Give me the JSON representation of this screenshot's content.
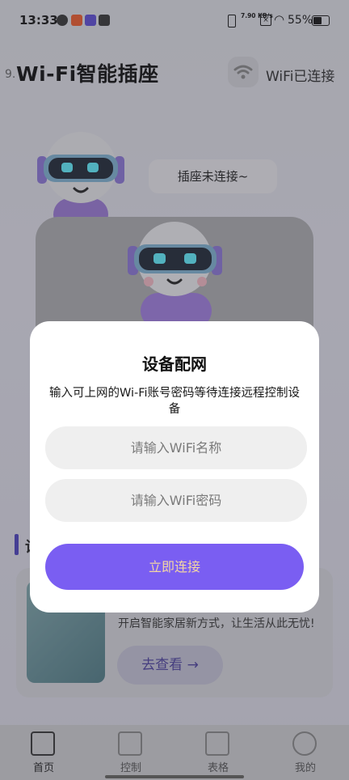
{
  "status_bar": {
    "time": "13:33",
    "network_speed": "7.90 KB/s",
    "battery": "55%"
  },
  "header": {
    "title": "Wi-Fi智能插座",
    "wifi_status": "WiFi已连接",
    "small_prefix": "9."
  },
  "device": {
    "status_chip": "插座未连接~"
  },
  "section": {
    "title_partial": "设"
  },
  "promo": {
    "text": "开启智能家居新方式，让生活从此无忧!",
    "button_label": "去查看 →"
  },
  "bottom_nav": {
    "items": [
      {
        "label": "首页",
        "icon": "home-icon",
        "active": true
      },
      {
        "label": "控制",
        "icon": "control-icon",
        "active": false
      },
      {
        "label": "表格",
        "icon": "table-icon",
        "active": false
      },
      {
        "label": "我的",
        "icon": "profile-icon",
        "active": false
      }
    ]
  },
  "dialog": {
    "title": "设备配网",
    "description": "输入可上网的Wi-Fi账号密码等待连接远程控制设备",
    "ssid_placeholder": "请输入WiFi名称",
    "password_placeholder": "请输入WiFi密码",
    "connect_label": "立即连接"
  },
  "colors": {
    "accent": "#7a5ef2",
    "button_text": "#f3d6a3"
  }
}
